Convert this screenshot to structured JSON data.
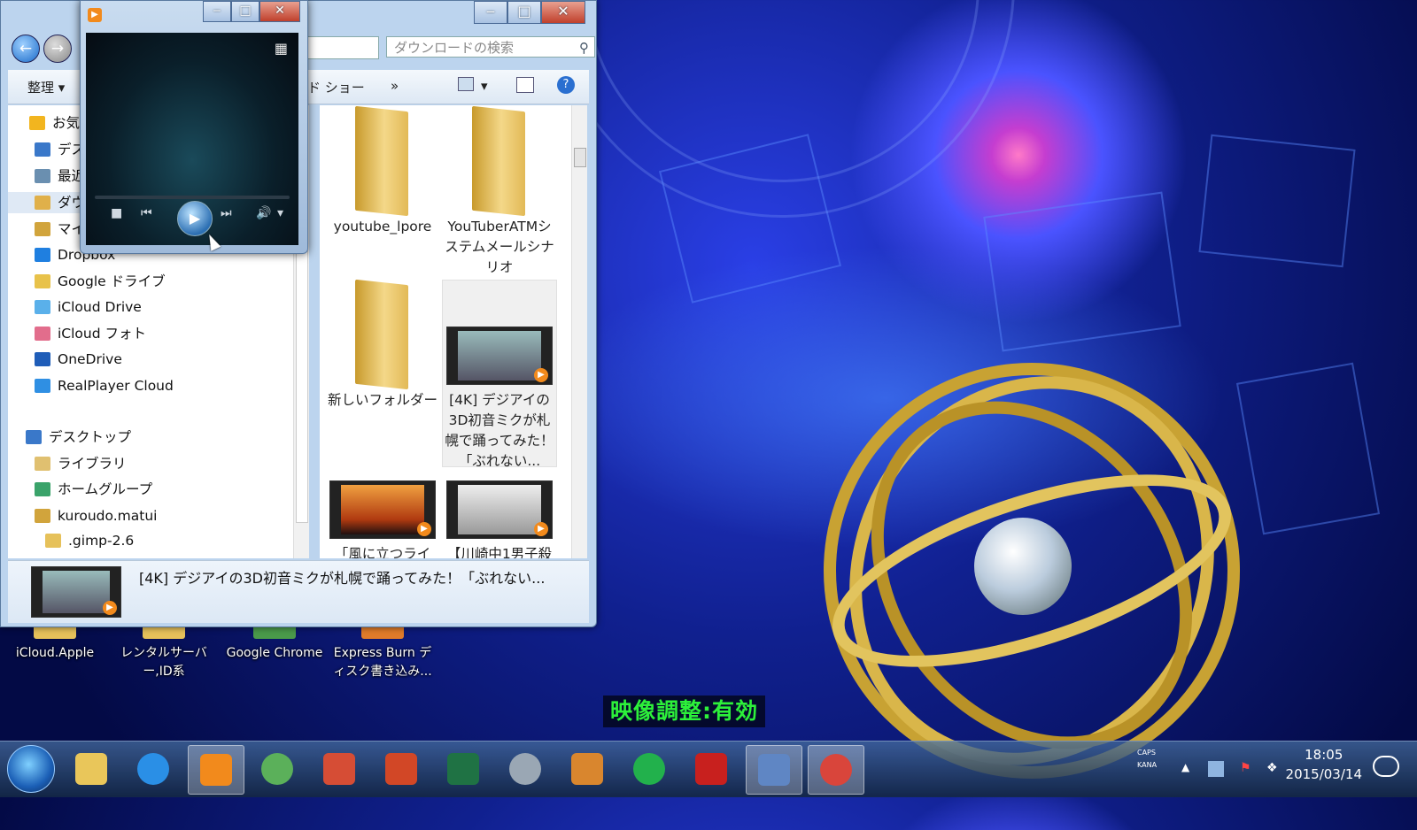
{
  "desktop": {
    "icons": [
      {
        "label": "iCloud.Apple"
      },
      {
        "label": "レンタルサーバ ー,ID系"
      },
      {
        "label": "Google Chrome"
      },
      {
        "label": "Express Burn デ ィスク書き込み..."
      }
    ],
    "osd_text": "映像調整:有効"
  },
  "explorer": {
    "search_placeholder": "ダウンロードの検索",
    "toolbar": {
      "organize_label": "整理 ▾",
      "slideshow_label": "ド ショー",
      "more_label": "»"
    },
    "nav_items": [
      {
        "label": "お気",
        "icon": "star-icon",
        "color": "#f2b51f"
      },
      {
        "label": "デス",
        "icon": "desktop-icon",
        "color": "#3a78c9"
      },
      {
        "label": "最近",
        "icon": "recent-places-icon",
        "color": "#6a8fb0"
      },
      {
        "label": "ダウ",
        "icon": "downloads-icon",
        "color": "#e0b04a"
      },
      {
        "label": "マイ",
        "icon": "my-folder-icon",
        "color": "#d1a43c"
      },
      {
        "label": "Dropbox",
        "icon": "dropbox-icon",
        "color": "#1f7fe0"
      },
      {
        "label": "Google ドライブ",
        "icon": "google-drive-icon",
        "color": "#e8c24a"
      },
      {
        "label": "iCloud Drive",
        "icon": "icloud-drive-icon",
        "color": "#5ab0ea"
      },
      {
        "label": "iCloud フォト",
        "icon": "icloud-photos-icon",
        "color": "#e26d8c"
      },
      {
        "label": "OneDrive",
        "icon": "onedrive-icon",
        "color": "#1f5db8"
      },
      {
        "label": "RealPlayer Cloud",
        "icon": "realplayer-cloud-icon",
        "color": "#2f8fe3"
      },
      {
        "label": "デスクトップ",
        "icon": "desktop-icon",
        "color": "#3a78c9"
      },
      {
        "label": "ライブラリ",
        "icon": "libraries-icon",
        "color": "#e0c070"
      },
      {
        "label": "ホームグループ",
        "icon": "homegroup-icon",
        "color": "#3aa36a"
      },
      {
        "label": "kuroudo.matui",
        "icon": "user-folder-icon",
        "color": "#d1a43c"
      },
      {
        "label": ".gimp-2.6",
        "icon": "folder-icon",
        "color": "#e6c15a"
      }
    ],
    "items": [
      {
        "label": "youtube_lpore",
        "kind": "folder"
      },
      {
        "label": "YouTuberATMシステムメールシナリオ",
        "kind": "folder"
      },
      {
        "label": "新しいフォルダー",
        "kind": "folder"
      },
      {
        "label": "[4K] デジアイの3D初音ミクが札幌で踊ってみた！「ぶれない...",
        "kind": "video",
        "selected": true
      },
      {
        "label": "「風に立つライ",
        "kind": "video"
      },
      {
        "label": "【川崎中1男子殺",
        "kind": "video"
      }
    ],
    "details_title": "[4K] デジアイの3D初音ミクが札幌で踊ってみた！「ぶれない..."
  },
  "player": {
    "title_icon": "media-player-icon"
  },
  "taskbar": {
    "apps": [
      {
        "name": "file-explorer",
        "color": "#e9c65a"
      },
      {
        "name": "internet-explorer",
        "color": "#2a8fe6"
      },
      {
        "name": "media-player",
        "color": "#f28a1c",
        "active": true
      },
      {
        "name": "recycle-app",
        "color": "#5bb05a"
      },
      {
        "name": "photo-app",
        "color": "#d64d35"
      },
      {
        "name": "powerpoint",
        "color": "#d24726"
      },
      {
        "name": "excel",
        "color": "#1f7244"
      },
      {
        "name": "film-reel",
        "color": "#9aa7b4"
      },
      {
        "name": "editor-app",
        "color": "#d9862e"
      },
      {
        "name": "line",
        "color": "#22b14c"
      },
      {
        "name": "landing-app",
        "color": "#c8201e"
      },
      {
        "name": "movie-maker",
        "color": "#5f86c4"
      },
      {
        "name": "chrome",
        "color": "#d9453b"
      }
    ],
    "caps_label": "CAPS",
    "kana_label": "KANA",
    "time": "18:05",
    "date": "2015/03/14"
  }
}
